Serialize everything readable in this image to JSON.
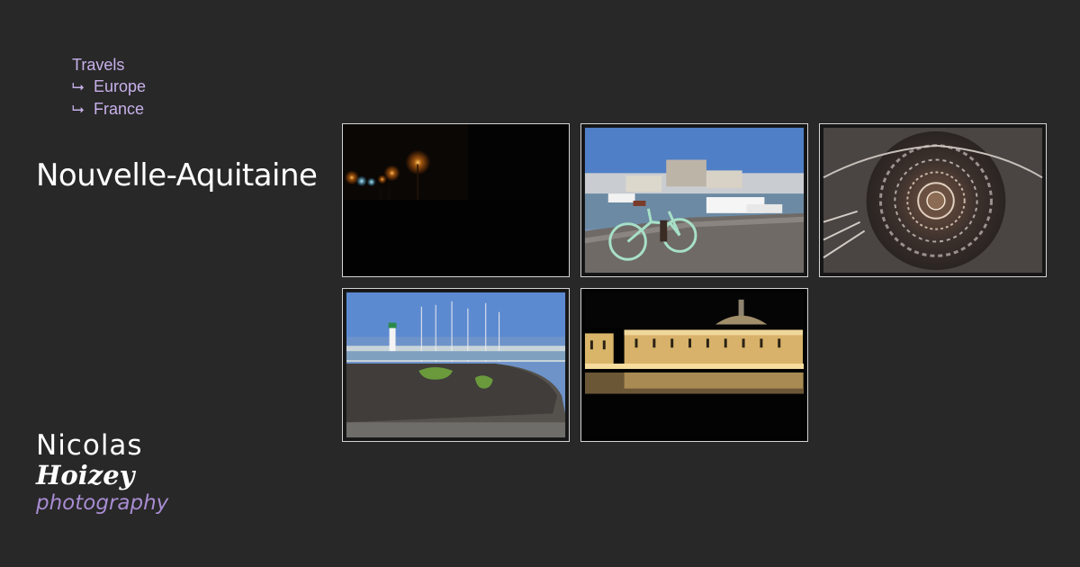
{
  "breadcrumb": {
    "items": [
      {
        "label": "Travels",
        "arrow": ""
      },
      {
        "label": "Europe",
        "arrow": "⮡"
      },
      {
        "label": "France",
        "arrow": "⮡"
      }
    ]
  },
  "page_title": "Nouvelle-Aquitaine",
  "colors": {
    "background": "#282828",
    "breadcrumb": "#c7b0ea",
    "logo_accent": "#a88cd3",
    "thumb_border": "#d4d4d4"
  },
  "gallery": {
    "photos": [
      {
        "name": "night-street-lights",
        "subject": "night scene with street lamps"
      },
      {
        "name": "bicycle-harbor",
        "subject": "green bicycle by a harbor with boats"
      },
      {
        "name": "spiral-staircase",
        "subject": "spiral staircase viewed from below"
      },
      {
        "name": "lighthouse-harbor",
        "subject": "harbor wall with lighthouse and sailboats"
      },
      {
        "name": "place-de-la-bourse-night",
        "subject": "illuminated palace reflected at night"
      }
    ]
  },
  "logo": {
    "line1": "Nicolas",
    "line2": "Hoizey",
    "line3": "photography"
  }
}
